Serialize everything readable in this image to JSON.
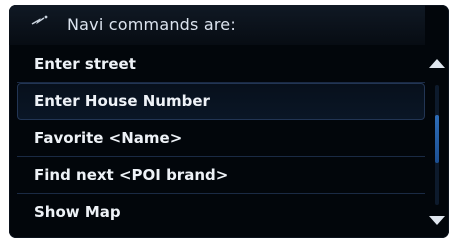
{
  "header": {
    "title": "Navi commands are:",
    "icon": "voice-command-icon"
  },
  "commands": [
    {
      "label": "Enter street"
    },
    {
      "label": "Enter House Number"
    },
    {
      "label": "Favorite <Name>"
    },
    {
      "label": "Find next <POI brand>"
    },
    {
      "label": "Show Map"
    }
  ],
  "selected_index": 1,
  "scroll": {
    "position_fraction": 0.42,
    "thumb_fraction": 0.4
  },
  "colors": {
    "background": "#02060b",
    "text": "#eef2f7",
    "accent": "#2e6db8",
    "divider": "#1a2a44"
  }
}
